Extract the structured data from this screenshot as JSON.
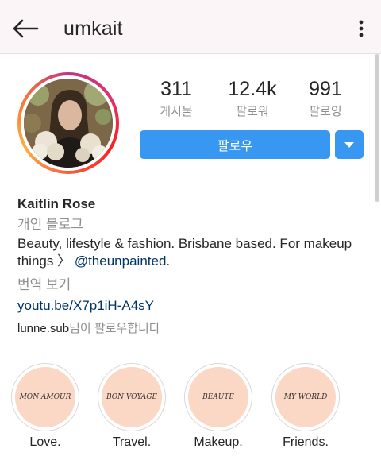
{
  "header": {
    "username": "umkait",
    "back_icon": "arrow-left-icon",
    "more_icon": "more-vertical-icon"
  },
  "profile": {
    "stats": [
      {
        "value": "311",
        "label": "게시물"
      },
      {
        "value": "12.4k",
        "label": "팔로워"
      },
      {
        "value": "991",
        "label": "팔로잉"
      }
    ],
    "follow_label": "팔로우",
    "dropdown_icon": "caret-down-icon",
    "accent_color": "#3897f0"
  },
  "bio": {
    "name": "Kaitlin Rose",
    "category": "개인 블로그",
    "text": "Beauty, lifestyle & fashion. Brisbane based. For makeup things 〉",
    "mention": "@theunpainted",
    "mention_suffix": ".",
    "translate": "번역 보기",
    "link": "youtu.be/X7p1iH-A4sY",
    "followed_by_user": "lunne.sub",
    "followed_by_suffix": "님이 팔로우합니다"
  },
  "highlights": [
    {
      "cover_text": "MON AMOUR",
      "label": "Love."
    },
    {
      "cover_text": "BON VOYAGE",
      "label": "Travel."
    },
    {
      "cover_text": "BEAUTE",
      "label": "Makeup."
    },
    {
      "cover_text": "MY WORLD",
      "label": "Friends."
    }
  ]
}
